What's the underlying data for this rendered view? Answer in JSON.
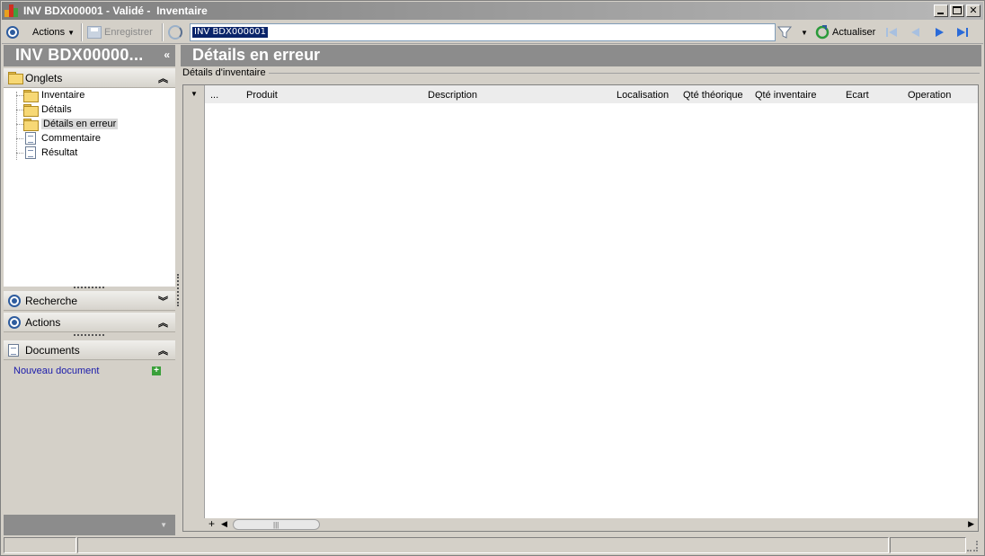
{
  "window": {
    "title": "INV BDX000001 - Validé -  Inventaire"
  },
  "toolbar": {
    "actions_label": "Actions",
    "save_label": "Enregistrer",
    "search_value": "INV BDX000001",
    "refresh_label": "Actualiser"
  },
  "left_panel": {
    "header": "INV BDX00000...",
    "tabs_section": "Onglets",
    "tabs": [
      {
        "label": "Inventaire",
        "icon": "folder-icon"
      },
      {
        "label": "Détails",
        "icon": "folder-icon"
      },
      {
        "label": "Détails en erreur",
        "icon": "folder-open-icon",
        "selected": true
      },
      {
        "label": "Commentaire",
        "icon": "document-icon"
      },
      {
        "label": "Résultat",
        "icon": "document-icon"
      }
    ],
    "search_section": "Recherche",
    "actions_section": "Actions",
    "documents_section": "Documents",
    "new_document_link": "Nouveau document"
  },
  "main": {
    "title": "Détails en erreur",
    "group_label": "Détails d'inventaire",
    "grid": {
      "columns": [
        "...",
        "Produit",
        "Description",
        "Localisation",
        "Qté théorique",
        "Qté inventaire",
        "Ecart",
        "Operation"
      ],
      "rows": []
    }
  },
  "colors": {
    "header_gray": "#8c8c8c",
    "accent_blue": "#2e5c9e",
    "link_blue": "#1a1aaa"
  }
}
